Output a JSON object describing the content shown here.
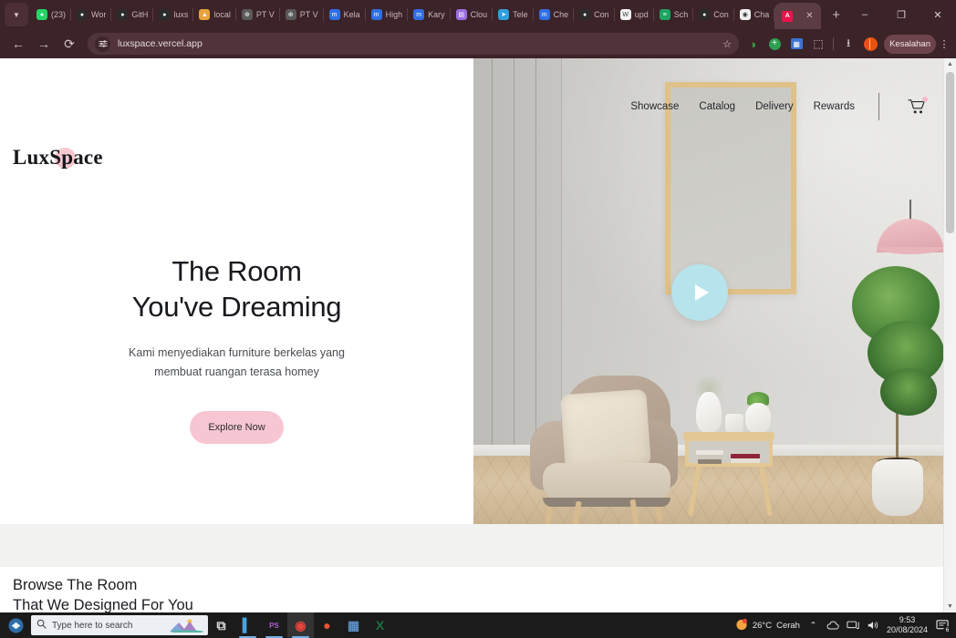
{
  "browser": {
    "tab_overflow_icon": "chevron-down-icon",
    "tabs": [
      {
        "label": "(23)",
        "icon": "whatsapp-icon",
        "color": "#25d366",
        "glyph": "●"
      },
      {
        "label": "Wor",
        "icon": "github-icon",
        "color": "#2b2b2b",
        "glyph": "●"
      },
      {
        "label": "GitH",
        "icon": "github-icon",
        "color": "#2b2b2b",
        "glyph": "●"
      },
      {
        "label": "luxs",
        "icon": "github-icon",
        "color": "#2b2b2b",
        "glyph": "●"
      },
      {
        "label": "local",
        "icon": "vite-icon",
        "color": "#e8a33d",
        "glyph": "▲"
      },
      {
        "label": "PT V",
        "icon": "globe-icon",
        "color": "#5a5a5a",
        "glyph": "⊕"
      },
      {
        "label": "PT V",
        "icon": "globe-icon",
        "color": "#5a5a5a",
        "glyph": "⊕"
      },
      {
        "label": "Kela",
        "icon": "moodle-icon",
        "color": "#2f6fe4",
        "glyph": "m"
      },
      {
        "label": "High",
        "icon": "moodle-icon",
        "color": "#2f6fe4",
        "glyph": "m"
      },
      {
        "label": "Kary",
        "icon": "moodle-icon",
        "color": "#2f6fe4",
        "glyph": "m"
      },
      {
        "label": "Clou",
        "icon": "cloud-app-icon",
        "color": "#9b6fe0",
        "glyph": "▤"
      },
      {
        "label": "Tele",
        "icon": "telegram-icon",
        "color": "#2ba0dc",
        "glyph": "➤"
      },
      {
        "label": "Che",
        "icon": "moodle-icon",
        "color": "#2f6fe4",
        "glyph": "m"
      },
      {
        "label": "Con",
        "icon": "github-icon",
        "color": "#2b2b2b",
        "glyph": "●"
      },
      {
        "label": "upd",
        "icon": "word-doc-icon",
        "color": "#f5f5f5",
        "glyph": "W"
      },
      {
        "label": "Sch",
        "icon": "sheets-icon",
        "color": "#1ea362",
        "glyph": "≡"
      },
      {
        "label": "Con",
        "icon": "github-icon",
        "color": "#2b2b2b",
        "glyph": "●"
      },
      {
        "label": "Cha",
        "icon": "chatgpt-icon",
        "color": "#f0f0f0",
        "glyph": "◉"
      }
    ],
    "active_tab": {
      "label": "",
      "icon": "figma-letter-icon",
      "color": "#e8134b",
      "glyph": "A"
    },
    "close_tab_glyph": "✕",
    "new_tab_glyph": "+",
    "window_minimize": "–",
    "window_maximize": "❐",
    "window_close": "✕",
    "back_glyph": "←",
    "forward_glyph": "→",
    "reload_glyph": "⟳",
    "url": "luxspace.vercel.app",
    "site_settings_icon": "tune-icon",
    "bookmark_icon": "star-icon",
    "extensions": [
      {
        "name": "adblock-icon",
        "color": "#3aa14a",
        "glyph": "◑"
      },
      {
        "name": "add-extension-icon",
        "color": "#2e9e4f",
        "glyph": "+"
      },
      {
        "name": "translate-icon",
        "color": "#3b72d4",
        "glyph": "▣"
      },
      {
        "name": "puzzle-extension-icon",
        "color": "#d9c6ca",
        "glyph": "⬚"
      }
    ],
    "download_icon": "download-icon",
    "profile_avatar_color": "#e8530f",
    "profile_label": "Kesalahan",
    "menu_icon": "kebab-menu-icon"
  },
  "site": {
    "logo": {
      "prefix": "Lux",
      "suffix": "Space",
      "accent_color": "#f7c6cf"
    },
    "nav": [
      {
        "label": "Showcase"
      },
      {
        "label": "Catalog"
      },
      {
        "label": "Delivery"
      },
      {
        "label": "Rewards"
      }
    ],
    "cart_icon": "shopping-cart-icon",
    "cart_badge_color": "#f9b7c8",
    "hero": {
      "title_line1": "The Room",
      "title_line2": "You've Dreaming",
      "subtitle_line1": "Kami menyediakan furniture berkelas yang",
      "subtitle_line2": "membuat ruangan terasa homey",
      "cta_label": "Explore Now",
      "cta_color": "#f7c6d2",
      "play_button_icon": "play-icon",
      "play_button_color": "#b7e4ec",
      "image_alt": "living-room-armchair-photo"
    },
    "browse": {
      "line1": "Browse The Room",
      "line2": "That We Designed For You"
    }
  },
  "scrollbar": {
    "up_glyph": "▲",
    "down_glyph": "▼"
  },
  "taskbar": {
    "start_icon": "windows-start-icon",
    "search_placeholder": "Type here to search",
    "items": [
      {
        "name": "task-view-icon",
        "color": "#d9d9d9",
        "glyph": "⧉",
        "active": false,
        "underline": false
      },
      {
        "name": "editor-icon",
        "color": "#4aa3e0",
        "glyph": "▍",
        "active": false,
        "underline": true
      },
      {
        "name": "phpstorm-icon",
        "color": "#b45bd8",
        "glyph": "PS",
        "active": false,
        "underline": true
      },
      {
        "name": "chrome-icon",
        "color": "#e8453c",
        "glyph": "◉",
        "active": true,
        "underline": true
      },
      {
        "name": "opera-icon",
        "color": "#ef5130",
        "glyph": "●",
        "active": false,
        "underline": false
      },
      {
        "name": "calculator-icon",
        "color": "#5b8ec4",
        "glyph": "▦",
        "active": false,
        "underline": false
      },
      {
        "name": "excel-icon",
        "color": "#1d7044",
        "glyph": "X",
        "active": false,
        "underline": false
      }
    ],
    "tray": {
      "weather_temp": "26°C",
      "weather_desc": "Cerah",
      "chevron_up": "⌃",
      "onedrive_icon": "onedrive-icon",
      "network_icon": "network-icon",
      "volume_icon": "volume-icon",
      "time": "9:53",
      "date": "20/08/2024",
      "notification_icon": "notification-icon",
      "notification_count": "6"
    }
  }
}
